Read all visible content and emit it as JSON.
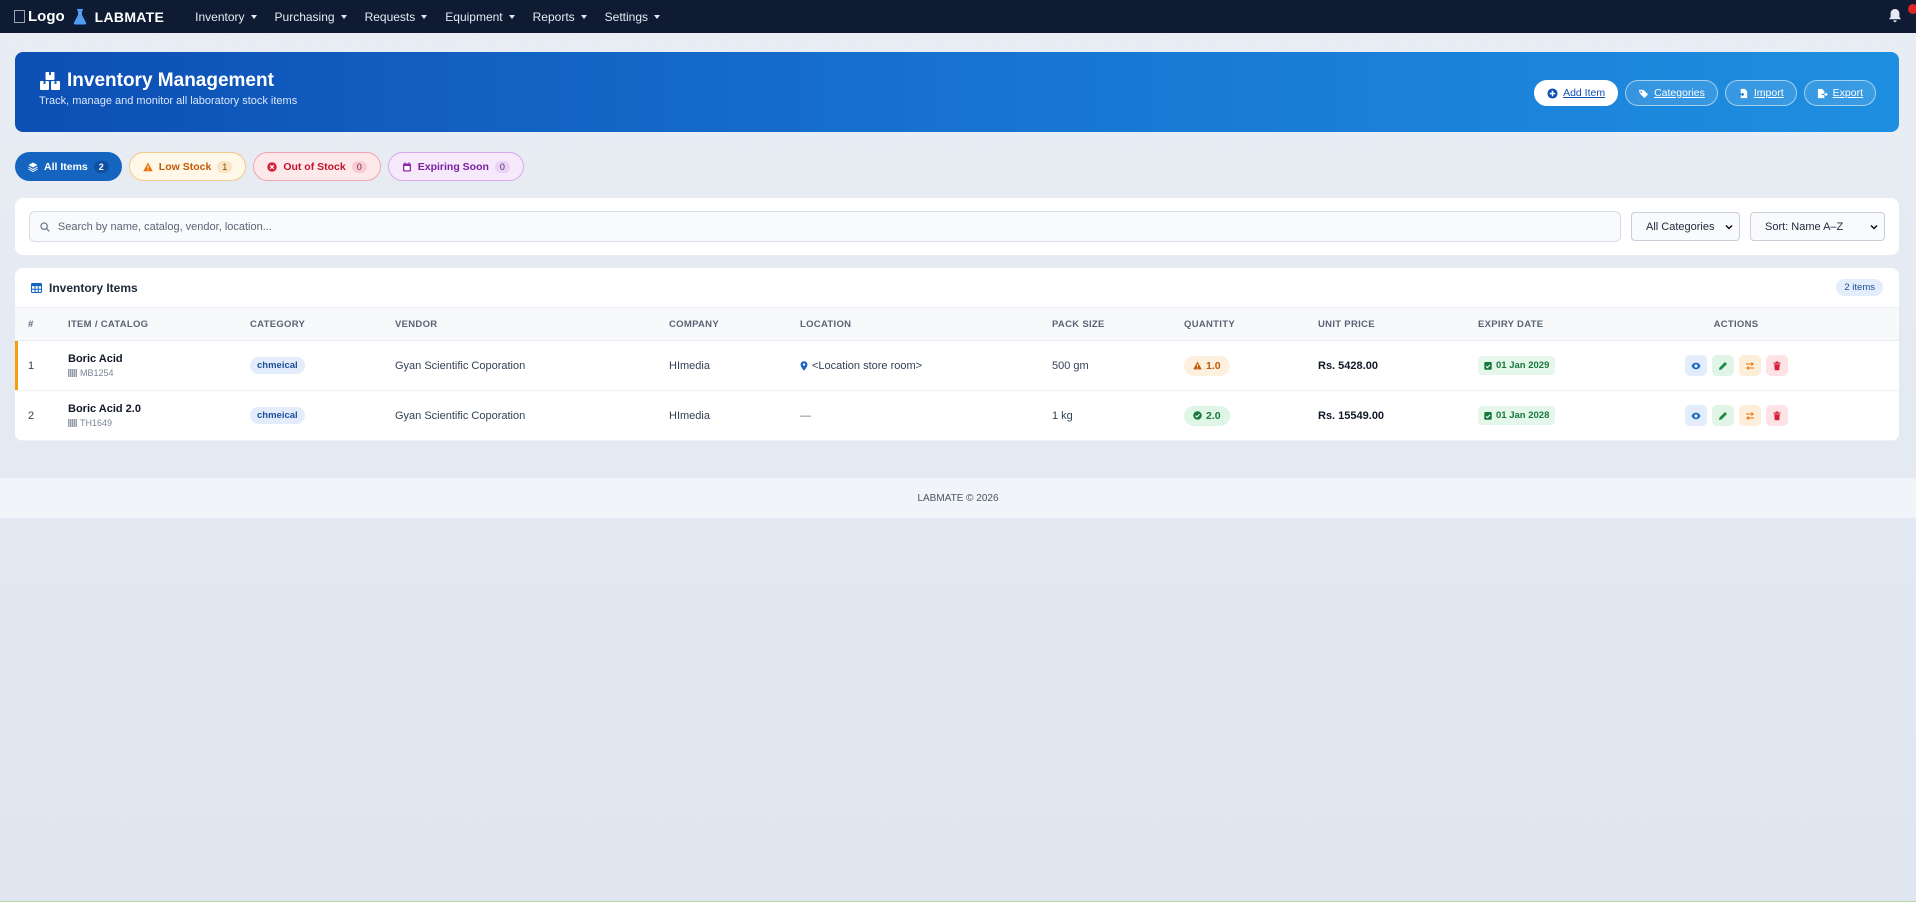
{
  "navbar": {
    "logo_alt": "Logo",
    "brand": "LABMATE",
    "items": [
      {
        "label": "Inventory"
      },
      {
        "label": "Purchasing"
      },
      {
        "label": "Requests"
      },
      {
        "label": "Equipment"
      },
      {
        "label": "Reports"
      },
      {
        "label": "Settings"
      }
    ],
    "notification_icon": "bell-icon"
  },
  "hero": {
    "title": "Inventory Management",
    "subtitle": "Track, manage and monitor all laboratory stock items",
    "actions": {
      "add": "Add Item",
      "categories": "Categories",
      "import": "Import",
      "export": "Export"
    }
  },
  "filters": {
    "all": {
      "label": "All Items",
      "count": "2"
    },
    "low": {
      "label": "Low Stock",
      "count": "1"
    },
    "out": {
      "label": "Out of Stock",
      "count": "0"
    },
    "expiring": {
      "label": "Expiring Soon",
      "count": "0"
    }
  },
  "search": {
    "placeholder": "Search by name, catalog, vendor, location...",
    "value": "",
    "category_select": "All Categories",
    "sort_select": "Sort: Name A–Z"
  },
  "table": {
    "title": "Inventory Items",
    "count_badge": "2 items",
    "columns": {
      "num": "#",
      "item": "ITEM / CATALOG",
      "category": "CATEGORY",
      "vendor": "VENDOR",
      "company": "COMPANY",
      "location": "LOCATION",
      "pack": "PACK SIZE",
      "quantity": "QUANTITY",
      "price": "UNIT PRICE",
      "expiry": "EXPIRY DATE",
      "actions": "ACTIONS"
    },
    "rows": [
      {
        "num": "1",
        "name": "Boric Acid",
        "catalog": "MB1254",
        "category": "chmeical",
        "vendor": "Gyan Scientific Coporation",
        "company": "HImedia",
        "location": "<Location store room>",
        "pack": "500 gm",
        "quantity": "1.0",
        "price": "Rs. 5428.00",
        "expiry": "01 Jan 2029"
      },
      {
        "num": "2",
        "name": "Boric Acid 2.0",
        "catalog": "TH1649",
        "category": "chmeical",
        "vendor": "Gyan Scientific Coporation",
        "company": "HImedia",
        "location": "—",
        "pack": "1 kg",
        "quantity": "2.0",
        "price": "Rs. 15549.00",
        "expiry": "01 Jan 2028"
      }
    ]
  },
  "footer": {
    "text": "LABMATE © 2026"
  },
  "colors": {
    "navbar": "#0f1b33",
    "primary": "#1565c0",
    "warning": "#f59e0b",
    "success": "#167a3c",
    "danger": "#c2132d"
  }
}
